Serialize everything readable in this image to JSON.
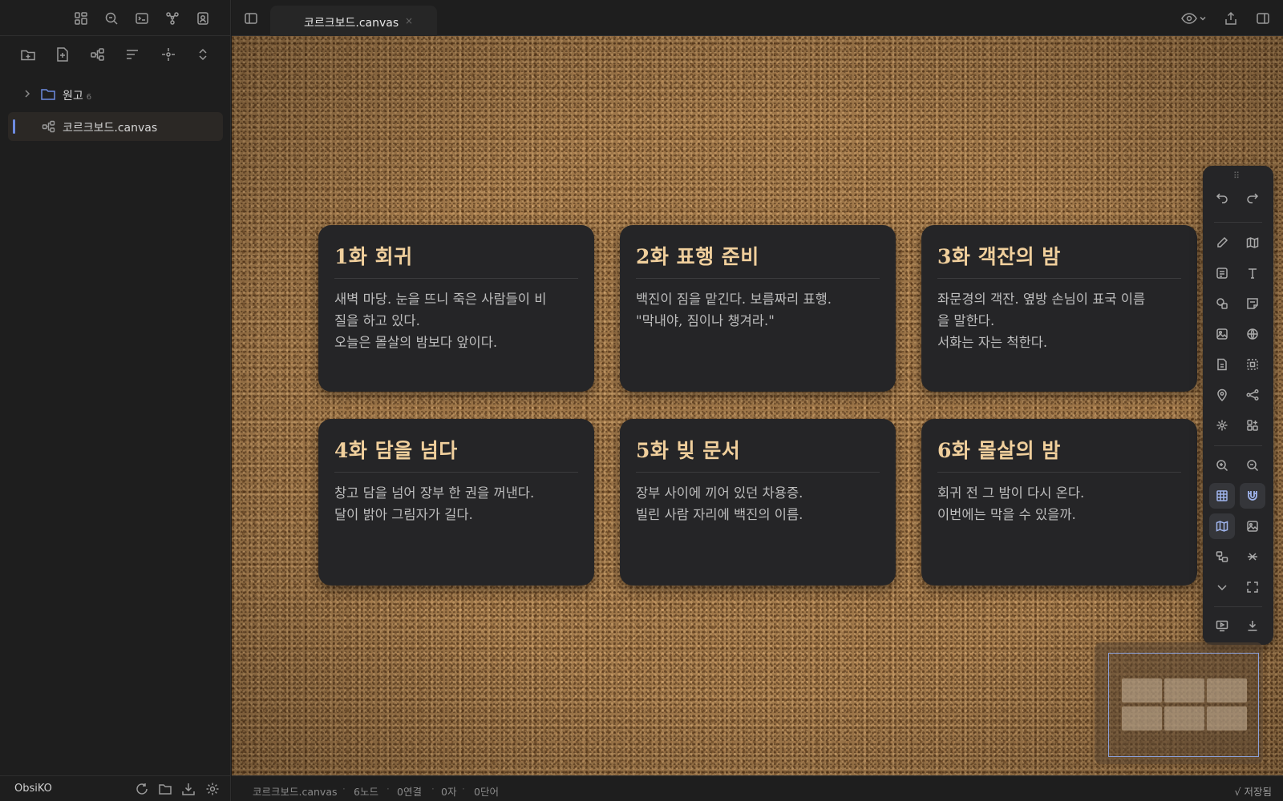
{
  "colors": {
    "accent": "#6d8be0",
    "card_title": "#f0cf9c",
    "card_bg": "#252527",
    "cork": "#a0784a"
  },
  "ribbon": {
    "icons": [
      "layout-grid-icon",
      "search-icon",
      "terminal-icon",
      "graph-icon",
      "contact-card-icon"
    ]
  },
  "file_nav": {
    "actions": [
      "new-folder-icon",
      "new-file-icon",
      "new-canvas-icon",
      "sort-icon",
      "reveal-file-icon",
      "collapse-all-icon"
    ],
    "items": [
      {
        "label": "원고",
        "count": "6",
        "type": "folder"
      },
      {
        "label": "코르크보드.canvas",
        "type": "canvas",
        "active": true
      }
    ]
  },
  "vault": {
    "name": "ObsiKO",
    "icons": [
      "sync-icon",
      "folder-icon",
      "download-icon",
      "settings-icon"
    ]
  },
  "tabs": [
    {
      "title": "코르크보드.canvas",
      "close": "×"
    }
  ],
  "cards": [
    {
      "title": "1화 회귀",
      "body": "새벽 마당. 눈을 뜨니 죽은 사람들이 비\n질을 하고 있다.\n오늘은 몰살의 밤보다 앞이다."
    },
    {
      "title": "2화 표행 준비",
      "body": "백진이 짐을 맡긴다. 보름짜리 표행.\n\"막내야, 짐이나 챙겨라.\""
    },
    {
      "title": "3화 객잔의 밤",
      "body": "좌문경의 객잔. 옆방 손님이 표국 이름\n을 말한다.\n서화는 자는 척한다."
    },
    {
      "title": "4화 담을 넘다",
      "body": "창고 담을 넘어 장부 한 권을 꺼낸다.\n달이 밝아 그림자가 길다."
    },
    {
      "title": "5화 빚 문서",
      "body": "장부 사이에 끼어 있던 차용증.\n빌린 사람 자리에 백진의 이름."
    },
    {
      "title": "6화 몰살의 밤",
      "body": "회귀 전 그 밤이 다시 온다.\n이번에는 막을 수 있을까."
    }
  ],
  "status": {
    "file": "코르크보드.canvas",
    "nodes": "6노드",
    "edges": "0연결",
    "chars": "0자",
    "words": "0단어",
    "saved": "√ 저장됨"
  }
}
